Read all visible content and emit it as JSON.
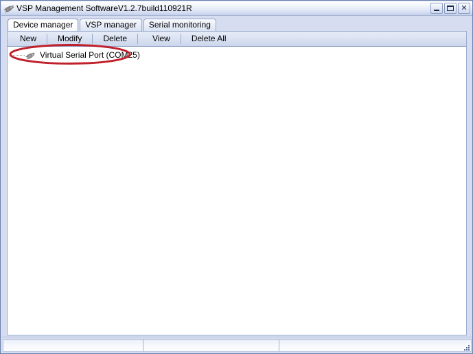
{
  "window": {
    "title": "VSP Management SoftwareV1.2.7build110921R",
    "icon": "plug-connector-icon",
    "controls": {
      "minimize_label": "",
      "maximize_label": "",
      "close_label": "✕"
    }
  },
  "tabs": [
    {
      "label": "Device manager",
      "active": true
    },
    {
      "label": "VSP manager",
      "active": false
    },
    {
      "label": "Serial monitoring",
      "active": false
    }
  ],
  "toolbar": {
    "buttons": [
      {
        "label": "New"
      },
      {
        "label": "Modify"
      },
      {
        "label": "Delete"
      },
      {
        "label": "View"
      },
      {
        "label": "Delete All"
      }
    ]
  },
  "content": {
    "tree": [
      {
        "label": "Virtual Serial Port (COM25)",
        "icon": "serial-port-plug-icon",
        "annotated": true
      }
    ]
  },
  "annotation": {
    "shape": "ellipse",
    "color": "#c0202b",
    "stroke_width": 3,
    "target": "Virtual Serial Port (COM25)"
  },
  "statusbar": {
    "panel1": "",
    "panel2": "",
    "panel3": ""
  },
  "colors": {
    "window_frame": "#6a7fae",
    "titlebar_top": "#ffffff",
    "titlebar_bottom": "#c3cfe8",
    "tab_area": "#d6ddf0",
    "toolbar_bg": "#dde4f3",
    "content_bg": "#ffffff",
    "annotation_red": "#c0202b",
    "text": "#000000"
  }
}
